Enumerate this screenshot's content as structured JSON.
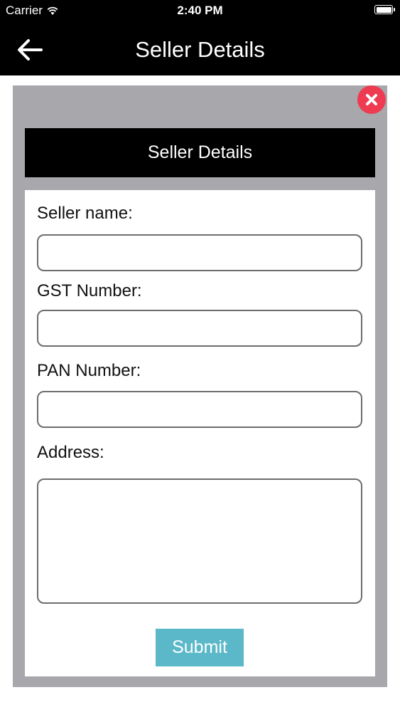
{
  "status_bar": {
    "carrier": "Carrier",
    "time": "2:40 PM"
  },
  "nav": {
    "title": "Seller Details",
    "back_icon": "arrow-left-icon"
  },
  "dialog": {
    "title": "Seller Details",
    "close_icon": "close-icon",
    "fields": {
      "seller_name": {
        "label": "Seller name:",
        "value": "",
        "placeholder": ""
      },
      "gst_number": {
        "label": "GST Number:",
        "value": "",
        "placeholder": ""
      },
      "pan_number": {
        "label": "PAN Number:",
        "value": "",
        "placeholder": ""
      },
      "address": {
        "label": "Address:",
        "value": "",
        "placeholder": ""
      }
    },
    "submit_label": "Submit"
  },
  "colors": {
    "bar_background": "#000000",
    "dialog_frame": "#a8a7ab",
    "close_button": "#ee3b52",
    "submit_button": "#5bb8c9"
  }
}
